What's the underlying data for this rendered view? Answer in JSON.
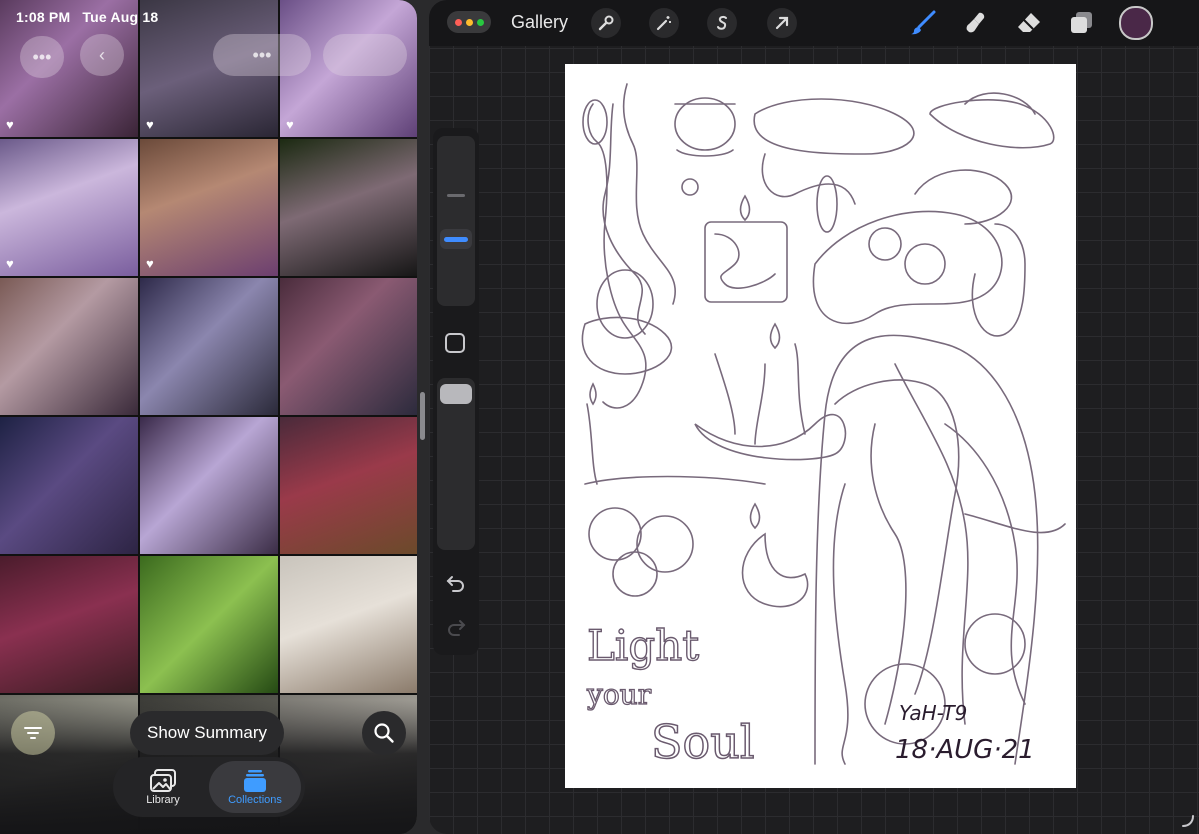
{
  "status_bar": {
    "time": "1:08 PM",
    "date": "Tue Aug 18"
  },
  "photos": {
    "tiles": [
      {
        "favorite": true
      },
      {
        "favorite": true
      },
      {
        "favorite": true
      },
      {
        "favorite": true
      },
      {
        "favorite": true
      },
      {
        "favorite": false
      },
      {
        "favorite": false
      },
      {
        "favorite": false
      },
      {
        "favorite": false
      },
      {
        "favorite": false
      },
      {
        "favorite": false
      },
      {
        "favorite": false
      },
      {
        "favorite": false
      },
      {
        "favorite": false
      },
      {
        "favorite": false
      },
      {
        "favorite": false
      },
      {
        "favorite": false
      },
      {
        "favorite": false
      }
    ],
    "show_summary_label": "Show Summary",
    "tabs": [
      {
        "label": "Library",
        "icon": "photo-library-icon",
        "active": false
      },
      {
        "label": "Collections",
        "icon": "collections-icon",
        "active": true
      }
    ],
    "accent_color": "#3f9cff"
  },
  "procreate": {
    "gallery_label": "Gallery",
    "tools": [
      "wrench-icon",
      "magic-wand-icon",
      "selection-s-icon",
      "arrow-transform-icon"
    ],
    "right_tools": [
      "brush-icon",
      "smudge-icon",
      "eraser-icon",
      "layers-icon"
    ],
    "current_color": "#4a2848",
    "brush_accent": "#3f8cff",
    "canvas": {
      "lettering": [
        "Light",
        "your",
        "Soul"
      ],
      "signature": "YaH-T9",
      "date_mark": "18·AUG·21"
    }
  }
}
